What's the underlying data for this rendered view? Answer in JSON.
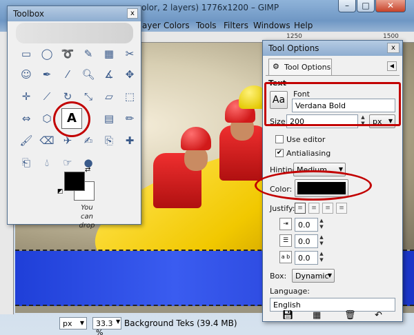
{
  "main_window": {
    "title": "olor, 2 layers) 1776x1200 – GIMP",
    "menu": [
      "ayer",
      "Colors",
      "Tools",
      "Filters",
      "Windows",
      "Help"
    ],
    "ruler_ticks": [
      "1250",
      "1500"
    ],
    "status": {
      "unit": "px",
      "zoom": "33.3 %",
      "layer_info": "Background Teks (39.4 MB)"
    },
    "window_buttons": [
      "–",
      "□",
      "✕"
    ]
  },
  "toolbox": {
    "title": "Toolbox",
    "close": "x",
    "text_tool_glyph": "A",
    "note": "You can drop"
  },
  "tool_options": {
    "title": "Tool Options",
    "close": "x",
    "tab_label": "Tool Options",
    "section_title": "Text",
    "font_label": "Font",
    "font_icon": "Aa",
    "font_value": "Verdana Bold",
    "size_label": "Size:",
    "size_value": "200",
    "size_unit": "px",
    "use_editor": "Use editor",
    "use_editor_checked": false,
    "antialiasing": "Antialiasing",
    "antialiasing_checked": true,
    "hinting_label": "Hinting:",
    "hinting_value": "Medium",
    "color_label": "Color:",
    "color_value": "#000000",
    "justify_label": "Justify:",
    "indent_value": "0.0",
    "line_spacing_value": "0.0",
    "letter_spacing_value": "0.0",
    "box_label": "Box:",
    "box_value": "Dynamic",
    "language_label": "Language:",
    "language_value": "English"
  },
  "colors": {
    "accent_red": "#c20000",
    "selection_blue": "#2b48de"
  }
}
